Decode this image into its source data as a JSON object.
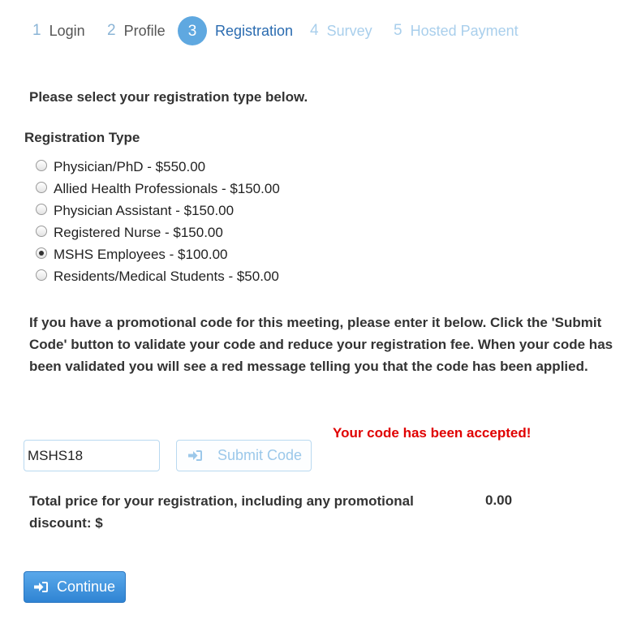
{
  "wizard": {
    "steps": [
      {
        "number": "1",
        "label": "Login",
        "state": "done"
      },
      {
        "number": "2",
        "label": "Profile",
        "state": "done"
      },
      {
        "number": "3",
        "label": "Registration",
        "state": "active"
      },
      {
        "number": "4",
        "label": "Survey",
        "state": "future"
      },
      {
        "number": "5",
        "label": "Hosted Payment",
        "state": "future"
      }
    ]
  },
  "intro_text": "Please select your registration type below.",
  "registration": {
    "title": "Registration Type",
    "selected_index": 4,
    "options": [
      "Physician/PhD - $550.00",
      "Allied Health Professionals - $150.00",
      "Physician Assistant - $150.00",
      "Registered Nurse - $150.00",
      "MSHS Employees - $100.00",
      "Residents/Medical Students - $50.00"
    ]
  },
  "promo": {
    "instructions": "If you have a promotional code for this meeting, please enter it below. Click the 'Submit Code' button to validate your code and reduce your registration fee. When your code has been validated you will see a red message telling you that the code has been applied.",
    "accepted_message": "Your code has been accepted!",
    "code_value": "MSHS18",
    "submit_label": "Submit Code",
    "submit_icon": "sign-in-icon"
  },
  "total": {
    "label": "Total price for your registration, including any promotional discount: $",
    "value": "0.00"
  },
  "continue": {
    "label": "Continue",
    "icon": "sign-in-icon"
  },
  "colors": {
    "accent": "#5fa8e0",
    "accepted_message": "#e00000",
    "continue_button": "#3a8fd9"
  }
}
